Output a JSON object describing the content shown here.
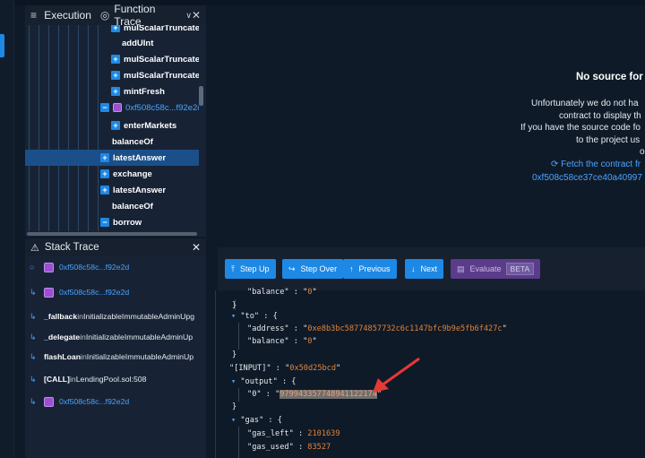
{
  "function_trace": {
    "menu_icon": "hamburger-icon",
    "tab_execution": "Execution",
    "tab_function_trace": "Function Trace",
    "rows": [
      {
        "label": "mulScalarTruncate",
        "expand": true
      },
      {
        "label": "addUInt",
        "expand": false
      },
      {
        "label": "mulScalarTruncateA",
        "expand": true
      },
      {
        "label": "mulScalarTruncateA",
        "expand": true
      },
      {
        "label": "mintFresh",
        "expand": true
      },
      {
        "label": "0xf508c58c...f92e2d",
        "expand": "minus",
        "contract": true
      },
      {
        "label": "enterMarkets",
        "expand": true
      },
      {
        "label": "balanceOf",
        "expand": false
      },
      {
        "label": "latestAnswer",
        "expand": true,
        "selected": true
      },
      {
        "label": "exchange",
        "expand": true
      },
      {
        "label": "latestAnswer",
        "expand": true
      },
      {
        "label": "balanceOf",
        "expand": false
      },
      {
        "label": "borrow",
        "expand": "minus"
      }
    ]
  },
  "stack_trace": {
    "title": "Stack Trace",
    "rows": [
      {
        "icon": "circle",
        "contract": true,
        "addr": "0xf508c58c...f92e2d"
      },
      {
        "icon": "return",
        "contract": true,
        "addr": "0xf508c58c...f92e2d"
      },
      {
        "icon": "return",
        "fn": "_fallback",
        "in": "in",
        "src": "InitializableImmutableAdminUpg"
      },
      {
        "icon": "return",
        "fn": "_delegate",
        "in": "in",
        "src": "InitializableImmutableAdminUp"
      },
      {
        "icon": "return",
        "fn": "flashLoan",
        "in": "in",
        "src": "InitializableImmutableAdminUp"
      },
      {
        "icon": "return",
        "fn": "[CALL]",
        "in": "in",
        "src": "LendingPool.sol:508"
      },
      {
        "icon": "return",
        "contract": true,
        "addr": "0xf508c58c...f92e2d"
      }
    ]
  },
  "no_source": {
    "title": "No source for",
    "lines": [
      "Unfortunately we do not ha",
      "contract to display th",
      "If you have the source code fo",
      "to the project us",
      "o"
    ],
    "fetch": "Fetch the contract fr",
    "fetch_addr": "0xf508c58ce37ce40a40997"
  },
  "toolbar": {
    "step_up": "Step Up",
    "step_over": "Step Over",
    "previous": "Previous",
    "next": "Next",
    "evaluate": "Evaluate",
    "beta": "BETA"
  },
  "json": {
    "balance_cut_key": "balance",
    "balance_cut_val": "0",
    "to_key": "to",
    "address_key": "address",
    "address_val": "0xe8b3bc58774857732c6c1147bfc9b9e5fb6f427c",
    "balance_key": "balance",
    "balance_val": "0",
    "input_key": "[INPUT]",
    "input_val": "0x50d25bcd",
    "output_key": "output",
    "zero_key": "0",
    "output_val": "979943357748941122174",
    "gas_key": "gas",
    "gas_left_key": "gas_left",
    "gas_left_val": "2101639",
    "gas_used_key": "gas_used",
    "gas_used_val": "83527"
  },
  "colors": {
    "accent": "#1e88e5",
    "highlight": "#e0833a",
    "annotation_arrow": "#e53935"
  }
}
